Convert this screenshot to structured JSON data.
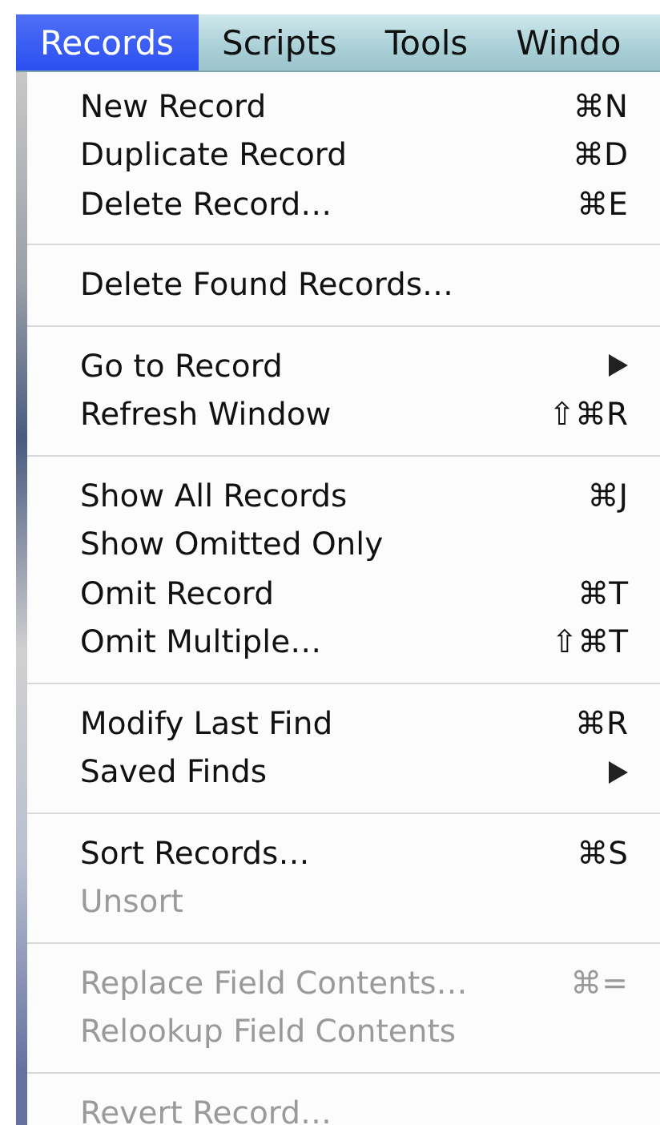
{
  "menu_bar": [
    {
      "label": "Records",
      "selected": true
    },
    {
      "label": "Scripts",
      "selected": false
    },
    {
      "label": "Tools",
      "selected": false
    },
    {
      "label": "Windo",
      "selected": false
    }
  ],
  "menu": {
    "groups": [
      {
        "items": [
          {
            "label": "New Record",
            "shortcut": "⌘N",
            "kind": "command",
            "disabled": false
          },
          {
            "label": "Duplicate Record",
            "shortcut": "⌘D",
            "kind": "command",
            "disabled": false
          },
          {
            "label": "Delete Record…",
            "shortcut": "⌘E",
            "kind": "command",
            "disabled": false
          }
        ]
      },
      {
        "items": [
          {
            "label": "Delete Found Records…",
            "kind": "command",
            "disabled": false
          }
        ]
      },
      {
        "items": [
          {
            "label": "Go to Record",
            "kind": "submenu",
            "disabled": false
          },
          {
            "label": "Refresh Window",
            "shortcut": "⇧⌘R",
            "kind": "command",
            "disabled": false
          }
        ]
      },
      {
        "items": [
          {
            "label": "Show All Records",
            "shortcut": "⌘J",
            "kind": "command",
            "disabled": false
          },
          {
            "label": "Show Omitted Only",
            "kind": "command",
            "disabled": false
          },
          {
            "label": "Omit Record",
            "shortcut": "⌘T",
            "kind": "command",
            "disabled": false
          },
          {
            "label": "Omit Multiple…",
            "shortcut": "⇧⌘T",
            "kind": "command",
            "disabled": false
          }
        ]
      },
      {
        "items": [
          {
            "label": "Modify Last Find",
            "shortcut": "⌘R",
            "kind": "command",
            "disabled": false
          },
          {
            "label": "Saved Finds",
            "kind": "submenu",
            "disabled": false
          }
        ]
      },
      {
        "items": [
          {
            "label": "Sort Records…",
            "shortcut": "⌘S",
            "kind": "command",
            "disabled": false
          },
          {
            "label": "Unsort",
            "kind": "command",
            "disabled": true
          }
        ]
      },
      {
        "items": [
          {
            "label": "Replace Field Contents…",
            "shortcut": "⌘=",
            "kind": "command",
            "disabled": true
          },
          {
            "label": "Relookup Field Contents",
            "kind": "command",
            "disabled": true
          }
        ]
      },
      {
        "items": [
          {
            "label": "Revert Record…",
            "kind": "command",
            "disabled": true
          }
        ]
      }
    ]
  }
}
